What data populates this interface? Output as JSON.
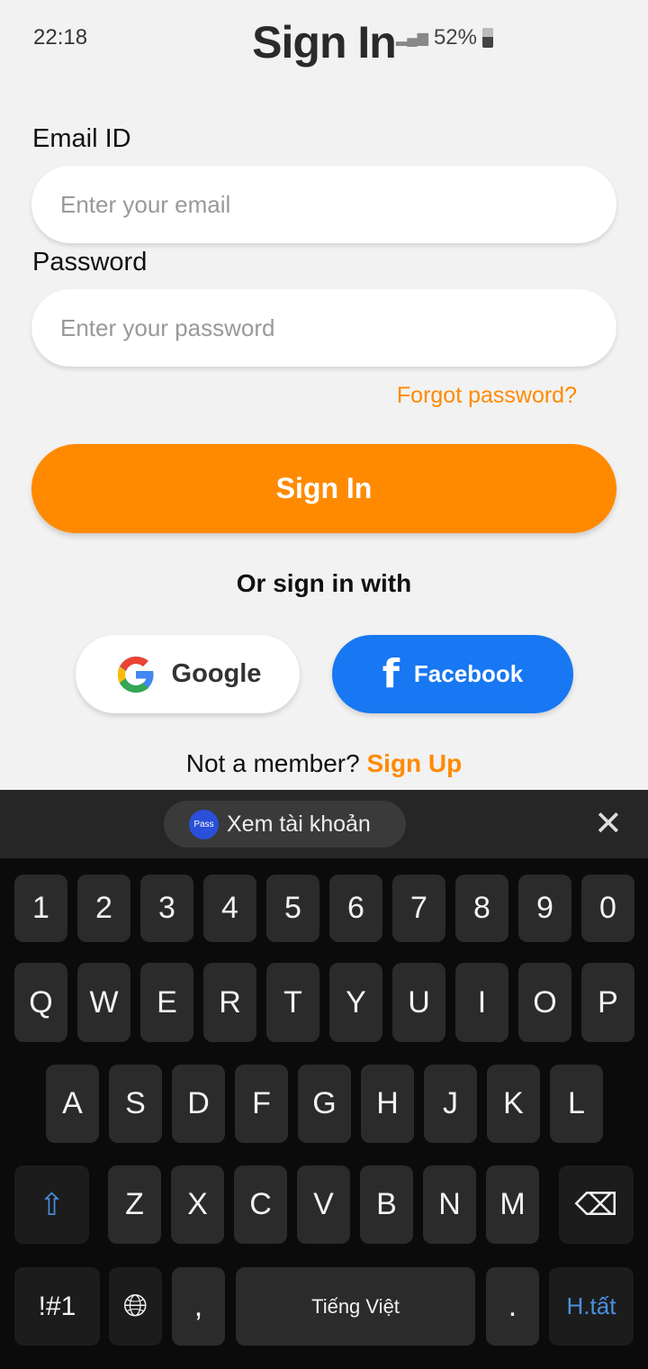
{
  "status": {
    "time": "22:18",
    "battery": "52%"
  },
  "title": "Sign In",
  "email": {
    "label": "Email ID",
    "placeholder": "Enter your email"
  },
  "password": {
    "label": "Password",
    "placeholder": "Enter your password"
  },
  "forgot": "Forgot password?",
  "signin": "Sign In",
  "or": "Or sign in with",
  "google": "Google",
  "facebook": "Facebook",
  "member": {
    "text": "Not a member?",
    "link": "Sign Up"
  },
  "keyboard": {
    "suggestion": "Xem tài khoản",
    "pass_icon": "Pass",
    "rows": [
      [
        "1",
        "2",
        "3",
        "4",
        "5",
        "6",
        "7",
        "8",
        "9",
        "0"
      ],
      [
        "Q",
        "W",
        "E",
        "R",
        "T",
        "Y",
        "U",
        "I",
        "O",
        "P"
      ],
      [
        "A",
        "S",
        "D",
        "F",
        "G",
        "H",
        "J",
        "K",
        "L"
      ],
      [
        "Z",
        "X",
        "C",
        "V",
        "B",
        "N",
        "M"
      ]
    ],
    "symbols": "!#1",
    "comma": ",",
    "space": "Tiếng Việt",
    "period": ".",
    "done": "H.tất"
  }
}
